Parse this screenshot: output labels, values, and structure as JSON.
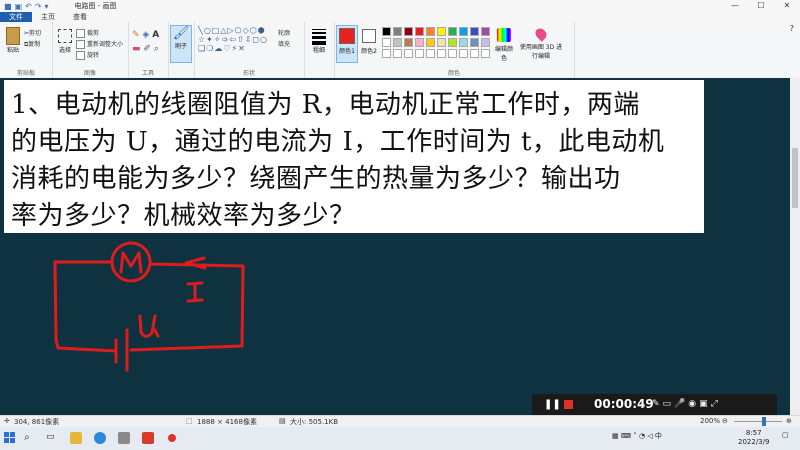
{
  "window": {
    "title": "电路图 - 画图"
  },
  "tabs": [
    "文件",
    "主页",
    "查看"
  ],
  "ribbon": {
    "clipboard": {
      "paste": "粘贴",
      "cut": "剪切",
      "copy": "复制",
      "label": "剪贴板"
    },
    "image": {
      "select": "选择",
      "crop": "裁剪",
      "resize": "重新调整大小",
      "rotate": "旋转",
      "label": "图像"
    },
    "tools": {
      "label": "工具"
    },
    "brush": {
      "label": "刷子"
    },
    "shapes": {
      "outline": "轮廓",
      "fill": "填充",
      "label": "形状"
    },
    "size": {
      "label": "粗细"
    },
    "color1": {
      "label": "颜色1",
      "value": "#e8231e"
    },
    "color2": {
      "label": "颜色2"
    },
    "colors_label": "颜色",
    "edit_colors": "编辑颜色",
    "paint3d": "使用画图 3D 进行编辑"
  },
  "palette": [
    "#000000",
    "#7f7f7f",
    "#880015",
    "#ed1c24",
    "#ff7f27",
    "#fff200",
    "#22b14c",
    "#00a2e8",
    "#3f48cc",
    "#a349a4",
    "#ffffff",
    "#c3c3c3",
    "#b97a57",
    "#ffaec9",
    "#ffc90e",
    "#efe4b0",
    "#b5e61d",
    "#99d9ea",
    "#7092be",
    "#c8bfe7"
  ],
  "question": {
    "lines": [
      "1、电动机的线圈阻值为 R，电动机正常工作时，两端",
      "的电压为 U，通过的电流为 I，工作时间为 t，此电动机",
      "消耗的电能为多少？绕圈产生的热量为多少？输出功",
      "率为多少？机械效率为多少？"
    ]
  },
  "drawing": {
    "motor_label": "M",
    "current_label": "I",
    "voltage_label": "U",
    "stroke": "#e01b1b"
  },
  "recorder": {
    "time": "00:00:49"
  },
  "status": {
    "cursor": "304, 861像素",
    "dimensions": "1888 × 4168像素",
    "filesize": "大小: 505.1KB",
    "zoom": "200%"
  },
  "taskbar": {
    "time": "8:57",
    "date": "2022/3/9"
  }
}
